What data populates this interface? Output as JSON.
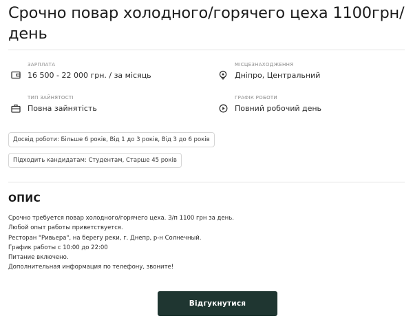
{
  "title": "Срочно повар холодного/горячего цеха 1100грн/день",
  "details": {
    "salary": {
      "label": "ЗАРПЛАТА",
      "value": "16 500 - 22 000 грн. / за місяць"
    },
    "location": {
      "label": "МІСЦЕЗНАХОДЖЕННЯ",
      "value": "Дніпро, Центральний"
    },
    "employment": {
      "label": "ТИП ЗАЙНЯТОСТІ",
      "value": "Повна зайнятість"
    },
    "schedule": {
      "label": "ГРАФІК РОБОТИ",
      "value": "Повний робочий день"
    }
  },
  "tags": [
    "Досвід роботи: Більше 6 років, Від 1 до 3 років, Від 3 до 6 років",
    "Підходить кандидатам: Студентам, Старше 45 років"
  ],
  "description": {
    "heading": "ОПИС",
    "lines": [
      "Срочно требуется повар холодного/горячего цеха. З/п 1100 грн за день.",
      "Любой опыт работы приветствуется.",
      "Ресторан \"Ривьера\", на берегу реки, г. Днепр, р-н Солнечный.",
      "График работы с 10:00 до 22:00",
      "Питание включено.",
      "Дополнительная информация по телефону, звоните!"
    ]
  },
  "apply_label": "Відгукнутися",
  "icons": {
    "salary": "wallet-icon",
    "location": "location-pin-icon",
    "employment": "briefcase-icon",
    "schedule": "clock-icon"
  },
  "colors": {
    "button_bg": "#1f3631",
    "button_text": "#ffffff"
  }
}
